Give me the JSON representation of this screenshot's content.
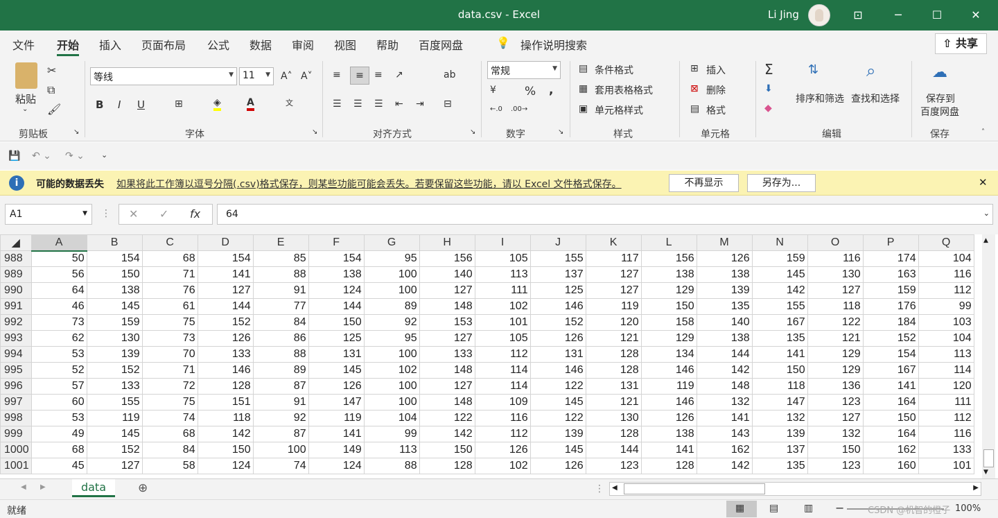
{
  "window": {
    "title": "data.csv  -  Excel",
    "user": "Li Jing",
    "controls": [
      "⊡",
      "─",
      "☐",
      "✕"
    ]
  },
  "menu": {
    "tabs": [
      "文件",
      "开始",
      "插入",
      "页面布局",
      "公式",
      "数据",
      "审阅",
      "视图",
      "帮助",
      "百度网盘"
    ],
    "active": "开始",
    "search": "操作说明搜索",
    "share": "共享"
  },
  "ribbon": {
    "clipboard": {
      "paste": "粘贴",
      "group": "剪贴板"
    },
    "font": {
      "name": "等线",
      "size": "11",
      "group": "字体",
      "bold": "B",
      "italic": "I",
      "underline": "U"
    },
    "alignment": {
      "group": "对齐方式"
    },
    "number": {
      "format": "常规",
      "group": "数字",
      "percent": "%",
      "comma": ","
    },
    "styles": {
      "conditional": "条件格式",
      "table": "套用表格格式",
      "cell": "单元格样式",
      "group": "样式"
    },
    "cells": {
      "insert": "插入",
      "delete": "删除",
      "format": "格式",
      "group": "单元格"
    },
    "editing": {
      "sort": "排序和筛选",
      "find": "查找和选择",
      "group": "编辑"
    },
    "save": {
      "line1": "保存到",
      "line2": "百度网盘",
      "group": "保存"
    }
  },
  "message": {
    "title": "可能的数据丢失",
    "text": "如果将此工作簿以逗号分隔(.csv)格式保存，则某些功能可能会丢失。若要保留这些功能，请以 Excel 文件格式保存。",
    "btn_dismiss": "不再显示",
    "btn_saveas": "另存为..."
  },
  "formula_bar": {
    "name_box": "A1",
    "fx": "fx",
    "value": "64"
  },
  "grid": {
    "columns": [
      "A",
      "B",
      "C",
      "D",
      "E",
      "F",
      "G",
      "H",
      "I",
      "J",
      "K",
      "L",
      "M",
      "N",
      "O",
      "P",
      "Q"
    ],
    "rows": [
      {
        "n": "988",
        "v": [
          50,
          154,
          68,
          154,
          85,
          154,
          95,
          156,
          105,
          155,
          117,
          156,
          126,
          159,
          116,
          174,
          104
        ]
      },
      {
        "n": "989",
        "v": [
          56,
          150,
          71,
          141,
          88,
          138,
          100,
          140,
          113,
          137,
          127,
          138,
          138,
          145,
          130,
          163,
          116
        ]
      },
      {
        "n": "990",
        "v": [
          64,
          138,
          76,
          127,
          91,
          124,
          100,
          127,
          111,
          125,
          127,
          129,
          139,
          142,
          127,
          159,
          112
        ]
      },
      {
        "n": "991",
        "v": [
          46,
          145,
          61,
          144,
          77,
          144,
          89,
          148,
          102,
          146,
          119,
          150,
          135,
          155,
          118,
          176,
          99
        ]
      },
      {
        "n": "992",
        "v": [
          73,
          159,
          75,
          152,
          84,
          150,
          92,
          153,
          101,
          152,
          120,
          158,
          140,
          167,
          122,
          184,
          103
        ]
      },
      {
        "n": "993",
        "v": [
          62,
          130,
          73,
          126,
          86,
          125,
          95,
          127,
          105,
          126,
          121,
          129,
          138,
          135,
          121,
          152,
          104
        ]
      },
      {
        "n": "994",
        "v": [
          53,
          139,
          70,
          133,
          88,
          131,
          100,
          133,
          112,
          131,
          128,
          134,
          144,
          141,
          129,
          154,
          113
        ]
      },
      {
        "n": "995",
        "v": [
          52,
          152,
          71,
          146,
          89,
          145,
          102,
          148,
          114,
          146,
          128,
          146,
          142,
          150,
          129,
          167,
          114
        ]
      },
      {
        "n": "996",
        "v": [
          57,
          133,
          72,
          128,
          87,
          126,
          100,
          127,
          114,
          122,
          131,
          119,
          148,
          118,
          136,
          141,
          120
        ]
      },
      {
        "n": "997",
        "v": [
          60,
          155,
          75,
          151,
          91,
          147,
          100,
          148,
          109,
          145,
          121,
          146,
          132,
          147,
          123,
          164,
          111
        ]
      },
      {
        "n": "998",
        "v": [
          53,
          119,
          74,
          118,
          92,
          119,
          104,
          122,
          116,
          122,
          130,
          126,
          141,
          132,
          127,
          150,
          112
        ]
      },
      {
        "n": "999",
        "v": [
          49,
          145,
          68,
          142,
          87,
          141,
          99,
          142,
          112,
          139,
          128,
          138,
          143,
          139,
          132,
          164,
          116
        ]
      },
      {
        "n": "1000",
        "v": [
          68,
          152,
          84,
          150,
          100,
          149,
          113,
          150,
          126,
          145,
          144,
          141,
          162,
          137,
          150,
          162,
          133
        ]
      },
      {
        "n": "1001",
        "v": [
          45,
          127,
          58,
          124,
          74,
          124,
          88,
          128,
          102,
          126,
          123,
          128,
          142,
          135,
          123,
          160,
          101
        ]
      }
    ]
  },
  "sheet_tab": "data",
  "status": {
    "ready": "就绪",
    "zoom": "100%",
    "watermark": "CSDN @机智的橙子"
  }
}
